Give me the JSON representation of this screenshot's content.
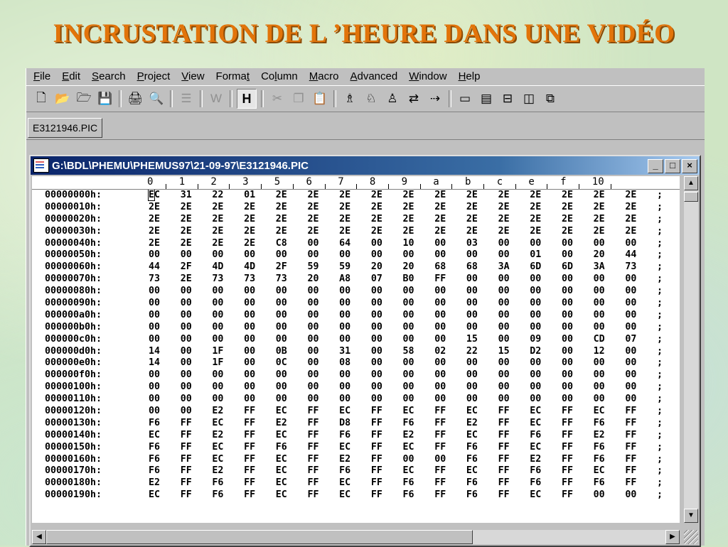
{
  "slide": {
    "title": "INCRUSTATION DE L ’HEURE DANS UNE VIDÉO"
  },
  "menubar": {
    "items": [
      {
        "u": "F",
        "rest": "ile"
      },
      {
        "u": "E",
        "rest": "dit"
      },
      {
        "u": "S",
        "rest": "earch"
      },
      {
        "u": "P",
        "rest": "roject"
      },
      {
        "u": "V",
        "rest": "iew"
      },
      {
        "pre": "Forma",
        "u": "t",
        "rest": ""
      },
      {
        "pre": "Co",
        "u": "l",
        "rest": "umn"
      },
      {
        "u": "M",
        "rest": "acro"
      },
      {
        "u": "A",
        "rest": "dvanced"
      },
      {
        "u": "W",
        "rest": "indow"
      },
      {
        "u": "H",
        "rest": "elp"
      }
    ]
  },
  "toolbar": {
    "buttons": [
      {
        "icon": "new-file-icon",
        "glyph": "🗋",
        "dis": false
      },
      {
        "icon": "open-folder-icon",
        "glyph": "📂",
        "dis": false
      },
      {
        "icon": "close-file-icon",
        "glyph": "🗁",
        "dis": false
      },
      {
        "icon": "save-icon",
        "glyph": "💾",
        "dis": true
      },
      {
        "sep": true
      },
      {
        "icon": "print-icon",
        "glyph": "🖨",
        "dis": false
      },
      {
        "icon": "print-preview-icon",
        "glyph": "🔍",
        "dis": false
      },
      {
        "sep": true
      },
      {
        "icon": "page-setup-icon",
        "glyph": "☰",
        "dis": true
      },
      {
        "sep": true
      },
      {
        "icon": "word-wrap-icon",
        "glyph": "W",
        "dis": true
      },
      {
        "sep": true
      },
      {
        "icon": "hex-mode-icon",
        "glyph": "H",
        "pressed": true
      },
      {
        "sep": true
      },
      {
        "icon": "cut-icon",
        "glyph": "✂",
        "dis": true
      },
      {
        "icon": "copy-icon",
        "glyph": "❐",
        "dis": true
      },
      {
        "icon": "paste-icon",
        "glyph": "📋",
        "dis": false
      },
      {
        "sep": true
      },
      {
        "icon": "find-icon",
        "glyph": "♗",
        "dis": false
      },
      {
        "icon": "find-previous-icon",
        "glyph": "♘",
        "dis": false
      },
      {
        "icon": "find-next-icon",
        "glyph": "♙",
        "dis": false
      },
      {
        "icon": "replace-icon",
        "glyph": "⇄",
        "dis": false
      },
      {
        "icon": "goto-icon",
        "glyph": "⇢",
        "dis": false
      },
      {
        "sep": true
      },
      {
        "icon": "output-window-icon",
        "glyph": "▭",
        "dis": false
      },
      {
        "icon": "directory-icon",
        "glyph": "▤",
        "dis": false
      },
      {
        "icon": "tile-horizontal-icon",
        "glyph": "⊟",
        "dis": false
      },
      {
        "icon": "tile-vertical-icon",
        "glyph": "◫",
        "dis": false
      },
      {
        "icon": "cascade-icon",
        "glyph": "⧉",
        "dis": false
      }
    ]
  },
  "tabs": [
    {
      "label": "E3121946.PIC"
    }
  ],
  "child_window": {
    "title": "G:\\BDL\\PHEMU\\PHEMUS97\\21-09-97\\E3121946.PIC",
    "btn_min": "_",
    "btn_max": "□",
    "btn_close": "×"
  },
  "ruler": {
    "labels": [
      "0",
      "1",
      "2",
      "3",
      "5",
      "6",
      "7",
      "8",
      "9",
      "a",
      "b",
      "c",
      "e",
      "f",
      "10"
    ]
  },
  "hex_rows": [
    {
      "addr": "00000000h:",
      "bytes": [
        "EC",
        "31",
        "22",
        "01",
        "2E",
        "2E",
        "2E",
        "2E",
        "2E",
        "2E",
        "2E",
        "2E",
        "2E",
        "2E",
        "2E",
        "2E"
      ]
    },
    {
      "addr": "00000010h:",
      "bytes": [
        "2E",
        "2E",
        "2E",
        "2E",
        "2E",
        "2E",
        "2E",
        "2E",
        "2E",
        "2E",
        "2E",
        "2E",
        "2E",
        "2E",
        "2E",
        "2E"
      ]
    },
    {
      "addr": "00000020h:",
      "bytes": [
        "2E",
        "2E",
        "2E",
        "2E",
        "2E",
        "2E",
        "2E",
        "2E",
        "2E",
        "2E",
        "2E",
        "2E",
        "2E",
        "2E",
        "2E",
        "2E"
      ]
    },
    {
      "addr": "00000030h:",
      "bytes": [
        "2E",
        "2E",
        "2E",
        "2E",
        "2E",
        "2E",
        "2E",
        "2E",
        "2E",
        "2E",
        "2E",
        "2E",
        "2E",
        "2E",
        "2E",
        "2E"
      ]
    },
    {
      "addr": "00000040h:",
      "bytes": [
        "2E",
        "2E",
        "2E",
        "2E",
        "C8",
        "00",
        "64",
        "00",
        "10",
        "00",
        "03",
        "00",
        "00",
        "00",
        "00",
        "00"
      ]
    },
    {
      "addr": "00000050h:",
      "bytes": [
        "00",
        "00",
        "00",
        "00",
        "00",
        "00",
        "00",
        "00",
        "00",
        "00",
        "00",
        "00",
        "01",
        "00",
        "20",
        "44"
      ]
    },
    {
      "addr": "00000060h:",
      "bytes": [
        "44",
        "2F",
        "4D",
        "4D",
        "2F",
        "59",
        "59",
        "20",
        "20",
        "68",
        "68",
        "3A",
        "6D",
        "6D",
        "3A",
        "73"
      ]
    },
    {
      "addr": "00000070h:",
      "bytes": [
        "73",
        "2E",
        "73",
        "73",
        "73",
        "20",
        "A8",
        "07",
        "B0",
        "FF",
        "00",
        "00",
        "00",
        "00",
        "00",
        "00"
      ]
    },
    {
      "addr": "00000080h:",
      "bytes": [
        "00",
        "00",
        "00",
        "00",
        "00",
        "00",
        "00",
        "00",
        "00",
        "00",
        "00",
        "00",
        "00",
        "00",
        "00",
        "00"
      ]
    },
    {
      "addr": "00000090h:",
      "bytes": [
        "00",
        "00",
        "00",
        "00",
        "00",
        "00",
        "00",
        "00",
        "00",
        "00",
        "00",
        "00",
        "00",
        "00",
        "00",
        "00"
      ]
    },
    {
      "addr": "000000a0h:",
      "bytes": [
        "00",
        "00",
        "00",
        "00",
        "00",
        "00",
        "00",
        "00",
        "00",
        "00",
        "00",
        "00",
        "00",
        "00",
        "00",
        "00"
      ]
    },
    {
      "addr": "000000b0h:",
      "bytes": [
        "00",
        "00",
        "00",
        "00",
        "00",
        "00",
        "00",
        "00",
        "00",
        "00",
        "00",
        "00",
        "00",
        "00",
        "00",
        "00"
      ]
    },
    {
      "addr": "000000c0h:",
      "bytes": [
        "00",
        "00",
        "00",
        "00",
        "00",
        "00",
        "00",
        "00",
        "00",
        "00",
        "15",
        "00",
        "09",
        "00",
        "CD",
        "07"
      ]
    },
    {
      "addr": "000000d0h:",
      "bytes": [
        "14",
        "00",
        "1F",
        "00",
        "0B",
        "00",
        "31",
        "00",
        "58",
        "02",
        "22",
        "15",
        "D2",
        "00",
        "12",
        "00"
      ]
    },
    {
      "addr": "000000e0h:",
      "bytes": [
        "14",
        "00",
        "1F",
        "00",
        "0C",
        "00",
        "08",
        "00",
        "00",
        "00",
        "00",
        "00",
        "00",
        "00",
        "00",
        "00"
      ]
    },
    {
      "addr": "000000f0h:",
      "bytes": [
        "00",
        "00",
        "00",
        "00",
        "00",
        "00",
        "00",
        "00",
        "00",
        "00",
        "00",
        "00",
        "00",
        "00",
        "00",
        "00"
      ]
    },
    {
      "addr": "00000100h:",
      "bytes": [
        "00",
        "00",
        "00",
        "00",
        "00",
        "00",
        "00",
        "00",
        "00",
        "00",
        "00",
        "00",
        "00",
        "00",
        "00",
        "00"
      ]
    },
    {
      "addr": "00000110h:",
      "bytes": [
        "00",
        "00",
        "00",
        "00",
        "00",
        "00",
        "00",
        "00",
        "00",
        "00",
        "00",
        "00",
        "00",
        "00",
        "00",
        "00"
      ]
    },
    {
      "addr": "00000120h:",
      "bytes": [
        "00",
        "00",
        "E2",
        "FF",
        "EC",
        "FF",
        "EC",
        "FF",
        "EC",
        "FF",
        "EC",
        "FF",
        "EC",
        "FF",
        "EC",
        "FF"
      ]
    },
    {
      "addr": "00000130h:",
      "bytes": [
        "F6",
        "FF",
        "EC",
        "FF",
        "E2",
        "FF",
        "D8",
        "FF",
        "F6",
        "FF",
        "E2",
        "FF",
        "EC",
        "FF",
        "F6",
        "FF"
      ]
    },
    {
      "addr": "00000140h:",
      "bytes": [
        "EC",
        "FF",
        "E2",
        "FF",
        "EC",
        "FF",
        "F6",
        "FF",
        "E2",
        "FF",
        "EC",
        "FF",
        "F6",
        "FF",
        "E2",
        "FF"
      ]
    },
    {
      "addr": "00000150h:",
      "bytes": [
        "F6",
        "FF",
        "EC",
        "FF",
        "F6",
        "FF",
        "EC",
        "FF",
        "EC",
        "FF",
        "F6",
        "FF",
        "EC",
        "FF",
        "F6",
        "FF"
      ]
    },
    {
      "addr": "00000160h:",
      "bytes": [
        "F6",
        "FF",
        "EC",
        "FF",
        "EC",
        "FF",
        "E2",
        "FF",
        "00",
        "00",
        "F6",
        "FF",
        "E2",
        "FF",
        "F6",
        "FF"
      ]
    },
    {
      "addr": "00000170h:",
      "bytes": [
        "F6",
        "FF",
        "E2",
        "FF",
        "EC",
        "FF",
        "F6",
        "FF",
        "EC",
        "FF",
        "EC",
        "FF",
        "F6",
        "FF",
        "EC",
        "FF"
      ]
    },
    {
      "addr": "00000180h:",
      "bytes": [
        "E2",
        "FF",
        "F6",
        "FF",
        "EC",
        "FF",
        "EC",
        "FF",
        "F6",
        "FF",
        "F6",
        "FF",
        "F6",
        "FF",
        "F6",
        "FF"
      ]
    },
    {
      "addr": "00000190h:",
      "bytes": [
        "EC",
        "FF",
        "F6",
        "FF",
        "EC",
        "FF",
        "EC",
        "FF",
        "F6",
        "FF",
        "F6",
        "FF",
        "EC",
        "FF",
        "00",
        "00"
      ]
    }
  ],
  "row_tail": ";",
  "scrollbar": {
    "up": "▲",
    "down": "▼",
    "left": "◀",
    "right": "▶"
  }
}
